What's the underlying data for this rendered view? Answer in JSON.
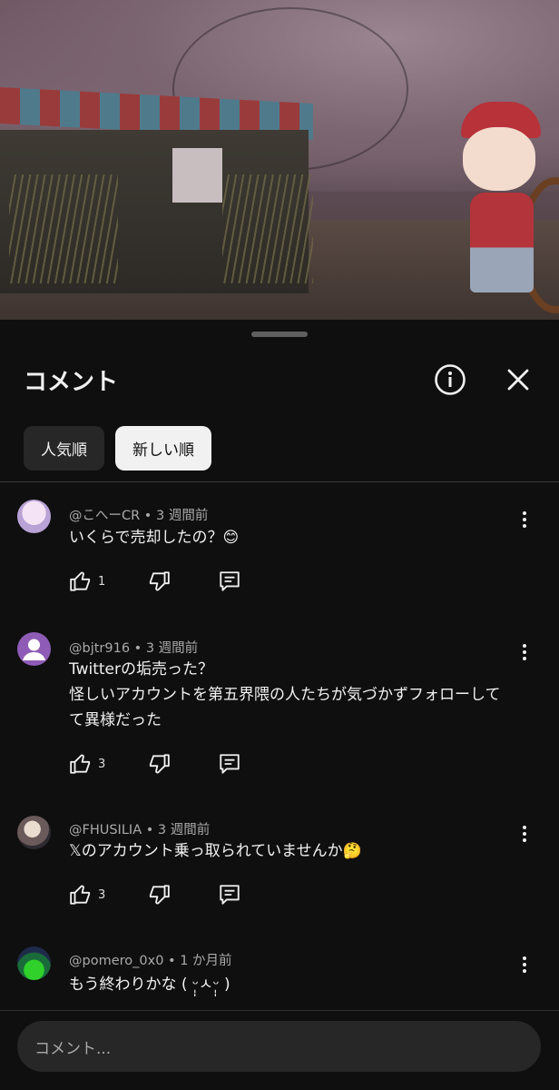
{
  "panel": {
    "title": "コメント",
    "chips": [
      {
        "label": "人気順",
        "active": false
      },
      {
        "label": "新しい順",
        "active": true
      }
    ]
  },
  "comments": [
    {
      "handle": "@こへーCR",
      "time": "3 週間前",
      "lines": [
        "いくらで売却したの？😊"
      ],
      "likes": "1",
      "avatar": "anime-girl-avatar"
    },
    {
      "handle": "@bjtr916",
      "time": "3 週間前",
      "lines": [
        "Twitterの垢売った？",
        "怪しいアカウントを第五界隈の人たちが気づかずフォローして",
        "て異様だった"
      ],
      "likes": "3",
      "avatar": "default-person-avatar"
    },
    {
      "handle": "@FHUSILIA",
      "time": "3 週間前",
      "lines": [
        "𝕏のアカウント乗っ取られていませんか🤔"
      ],
      "likes": "3",
      "avatar": "character-avatar"
    },
    {
      "handle": "@pomero_0x0",
      "time": "1 か月前",
      "lines": [
        "もう終わりかな ( ᵕ̩̩ㅅᵕ̩̩ )"
      ],
      "likes": "",
      "avatar": "game-avatar"
    }
  ],
  "input": {
    "placeholder": "コメント..."
  },
  "colors": {
    "background": "#0f0f0f",
    "chip_active": "#f1f1f1",
    "chip_inactive": "#272727",
    "meta": "#aaaaaa",
    "default_avatar": "#8e5cb6"
  }
}
